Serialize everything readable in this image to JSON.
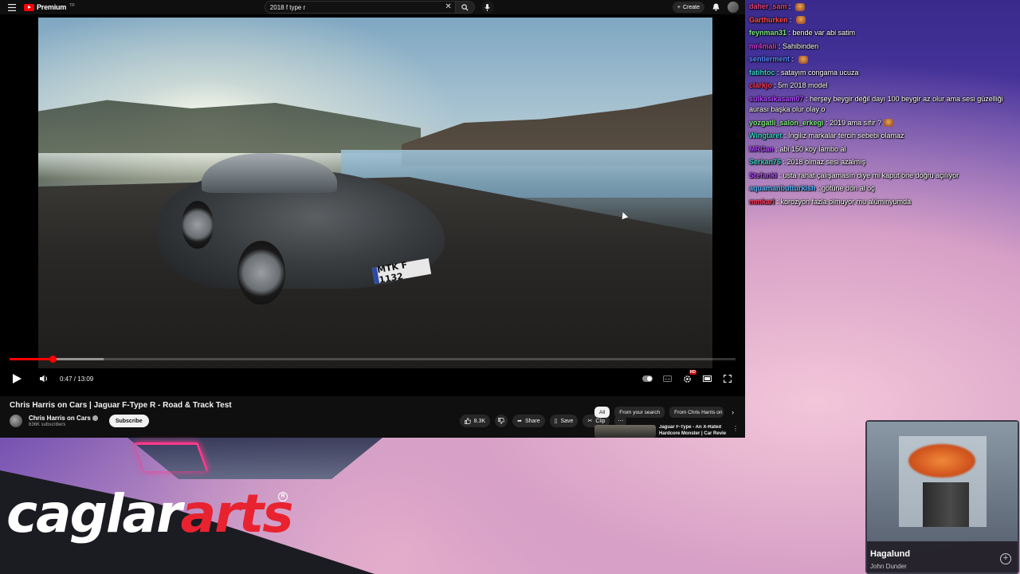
{
  "youtube": {
    "logo_text": "Premium",
    "logo_sup": "TR",
    "search_query": "2018 f type r",
    "create_label": "Create",
    "player": {
      "current_time": "0:47",
      "duration": "13:09",
      "time_display": "0:47 / 13:09",
      "played_fraction": 0.0596,
      "buffered_fraction": 0.13,
      "plate_text": "MTK F 1132",
      "hd_badge": "HD"
    },
    "video_title": "Chris Harris on Cars | Jaguar F-Type R - Road & Track Test",
    "channel": {
      "name": "Chris Harris on Cars",
      "subscribers": "636K subscribers",
      "subscribe_label": "Subscribe"
    },
    "actions": {
      "likes": "8.3K",
      "share": "Share",
      "save": "Save",
      "clip": "Clip"
    },
    "chips": [
      "All",
      "From your search",
      "From Chris Harris on C"
    ],
    "recommended": {
      "title": "Jaguar F-Type - An X-Rated Hardcore Monster | Car Revie"
    }
  },
  "chat": {
    "messages": [
      {
        "user": "daher_sam",
        "color": "#e0457b",
        "text": "",
        "emote": true
      },
      {
        "user": "Garthurken",
        "color": "#ff4d4d",
        "text": "",
        "emote": true
      },
      {
        "user": "feynman31",
        "color": "#7ce87c",
        "text": "bende var abi satim"
      },
      {
        "user": "mr4mali",
        "color": "#cf3bd1",
        "text": "Sahibinden"
      },
      {
        "user": "sentierment",
        "color": "#5a8cff",
        "text": "",
        "emote": true
      },
      {
        "user": "fatihtoc",
        "color": "#3ad1c4",
        "text": "satayım congama ucuza"
      },
      {
        "user": "clarkjo",
        "color": "#ff3b5c",
        "text": "5m 2018 model"
      },
      {
        "user": "sulkasikasam07",
        "color": "#b34aff",
        "text": "herşey beygir değil dayı 100 beygir az olur ama sesi güzelliği aurası başka olur olay o"
      },
      {
        "user": "yozgatli_salon_erkegi",
        "color": "#7ce87c",
        "text": "2019 ama sıfır ?",
        "emote": true
      },
      {
        "user": "Wingtaret",
        "color": "#3ad1c4",
        "text": "İngiliz markalar tercih sebebi olamaz"
      },
      {
        "user": "MRCan",
        "color": "#b34aff",
        "text": "abi 150 koy İambo al"
      },
      {
        "user": "Serkan76",
        "color": "#3ad1c4",
        "text": "2018 olmaz sesi azalmış"
      },
      {
        "user": "Stefanki",
        "color": "#b34aff",
        "text": "usta rahat çalışamasın diye mi kaput öne doğru açılıyor"
      },
      {
        "user": "aquamanbutturkish",
        "color": "#5ab8ff",
        "text": "götüne don al oç"
      },
      {
        "user": "mmkarl",
        "color": "#ff3b5c",
        "text": "korozyon fazla olmuyor mu alüminyumda"
      }
    ]
  },
  "now_playing": {
    "track": "Hagalund",
    "artist": "John Dunder"
  },
  "branding": {
    "part1": "caglar",
    "part2": "arts",
    "reg": "R",
    "primary_color": "#ffffff",
    "accent_color": "#e8232f"
  }
}
